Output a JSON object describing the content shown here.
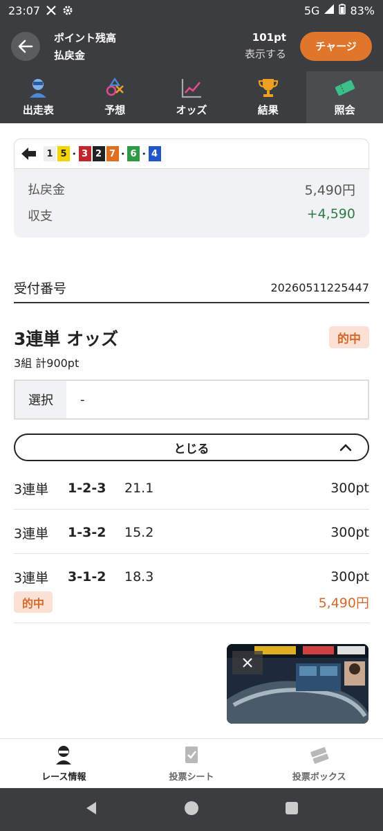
{
  "status_bar": {
    "time": "23:07",
    "network": "5G",
    "battery": "83%"
  },
  "header": {
    "point_label": "ポイント残高",
    "point_value": "101pt",
    "payout_label": "払戻金",
    "payout_value": "表示する",
    "charge_label": "チャージ"
  },
  "tabs": [
    {
      "label": "出走表",
      "icon": "racer-icon"
    },
    {
      "label": "予想",
      "icon": "prediction-icon"
    },
    {
      "label": "オッズ",
      "icon": "odds-chart-icon"
    },
    {
      "label": "結果",
      "icon": "trophy-icon"
    },
    {
      "label": "照会",
      "icon": "ticket-icon",
      "active": true
    }
  ],
  "ticket": {
    "numbers": [
      {
        "n": "1",
        "bg": "#eeeeee",
        "fg": "#222222"
      },
      {
        "n": "5",
        "bg": "#f5d400",
        "fg": "#222222"
      },
      {
        "sep": "•"
      },
      {
        "n": "3",
        "bg": "#c0272d",
        "fg": "#ffffff"
      },
      {
        "n": "2",
        "bg": "#222222",
        "fg": "#ffffff"
      },
      {
        "n": "7",
        "bg": "#e07020",
        "fg": "#ffffff"
      },
      {
        "sep": "•"
      },
      {
        "n": "6",
        "bg": "#2e9a46",
        "fg": "#ffffff"
      },
      {
        "sep": "•"
      },
      {
        "n": "4",
        "bg": "#1f55c8",
        "fg": "#ffffff"
      }
    ],
    "payout_label": "払戻金",
    "payout_value": "5,490円",
    "balance_label": "収支",
    "balance_value": "+4,590"
  },
  "receipt": {
    "label": "受付番号",
    "value": "20260511225447"
  },
  "bet": {
    "title": "3連単 オッズ",
    "hit_badge": "的中",
    "summary": "3組 計900pt",
    "select_label": "選択",
    "select_value": "-",
    "close_label": "とじる",
    "rows": [
      {
        "kind": "3連単",
        "combo": "1-2-3",
        "odds": "21.1",
        "amount": "300pt"
      },
      {
        "kind": "3連単",
        "combo": "1-3-2",
        "odds": "15.2",
        "amount": "300pt"
      },
      {
        "kind": "3連単",
        "combo": "3-1-2",
        "odds": "18.3",
        "amount": "300pt",
        "hit": "的中",
        "payout": "5,490円"
      }
    ]
  },
  "bottom_nav": [
    {
      "label": "レース情報",
      "icon": "racer-icon",
      "active": true
    },
    {
      "label": "投票シート",
      "icon": "sheet-icon"
    },
    {
      "label": "投票ボックス",
      "icon": "tickets-icon"
    }
  ],
  "colors": {
    "accent": "#e0762a",
    "header_bg": "#3b3d40",
    "hit_text": "#d5692a",
    "hit_bg": "#fbe1d3",
    "positive": "#2f7a4a"
  }
}
